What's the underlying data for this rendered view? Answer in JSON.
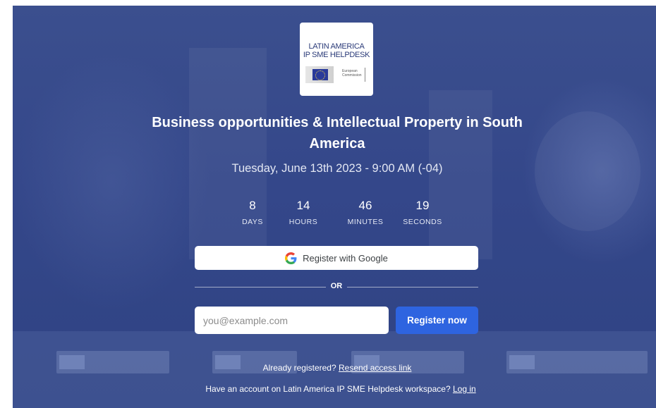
{
  "logo": {
    "line1": "LATIN AMERICA",
    "line2": "IP SME HELPDESK",
    "ec_text_1": "European",
    "ec_text_2": "Commission"
  },
  "event": {
    "title": "Business opportunities & Intellectual Property in South America",
    "date": "Tuesday, June 13th 2023 - 9:00 AM (-04)"
  },
  "countdown": [
    {
      "value": "8",
      "label": "DAYS"
    },
    {
      "value": "14",
      "label": "HOURS"
    },
    {
      "value": "46",
      "label": "MINUTES"
    },
    {
      "value": "19",
      "label": "SECONDS"
    }
  ],
  "register": {
    "google_label": "Register with Google",
    "or_label": "OR",
    "email_placeholder": "you@example.com",
    "email_value": "",
    "submit_label": "Register now"
  },
  "footer": {
    "already_text": "Already registered?",
    "resend_link": "Resend access link",
    "account_text": "Have an account on Latin America IP SME Helpdesk workspace?",
    "login_link": "Log in"
  },
  "colors": {
    "background": "#34478a",
    "primary_button": "#2e64e0",
    "text": "#ffffff"
  },
  "icons": [
    "google-icon",
    "eu-flag-icon"
  ]
}
